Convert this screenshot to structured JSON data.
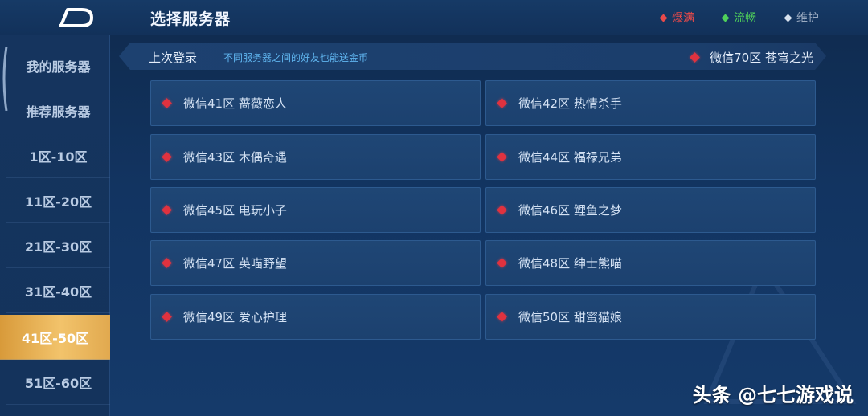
{
  "header": {
    "title": "选择服务器",
    "legend": {
      "hot": "爆满",
      "smooth": "流畅",
      "maintenance": "维护"
    }
  },
  "colors": {
    "hot": "#e84a4a",
    "smooth": "#4fd05a",
    "maintenance": "#d8e2ee",
    "active_tab": "#f2c36b"
  },
  "sidebar": {
    "items": [
      {
        "label": "我的服务器"
      },
      {
        "label": "推荐服务器"
      },
      {
        "label": "1区-10区"
      },
      {
        "label": "11区-20区"
      },
      {
        "label": "21区-30区"
      },
      {
        "label": "31区-40区"
      },
      {
        "label": "41区-50区"
      },
      {
        "label": "51区-60区"
      }
    ],
    "active": "41区-50区"
  },
  "last_login": {
    "label": "上次登录",
    "tip": "不同服务器之间的好友也能送金币",
    "server": "微信70区 苍穹之光"
  },
  "servers": [
    {
      "name": "微信41区 蔷薇恋人",
      "status": "hot"
    },
    {
      "name": "微信42区 热情杀手",
      "status": "hot"
    },
    {
      "name": "微信43区 木偶奇遇",
      "status": "hot"
    },
    {
      "name": "微信44区 福禄兄弟",
      "status": "hot"
    },
    {
      "name": "微信45区 电玩小子",
      "status": "hot"
    },
    {
      "name": "微信46区 鲤鱼之梦",
      "status": "hot"
    },
    {
      "name": "微信47区 英喵野望",
      "status": "hot"
    },
    {
      "name": "微信48区 绅士熊喵",
      "status": "hot"
    },
    {
      "name": "微信49区 爱心护理",
      "status": "hot"
    },
    {
      "name": "微信50区 甜蜜猫娘",
      "status": "hot"
    }
  ],
  "watermark": "头条 @七七游戏说"
}
